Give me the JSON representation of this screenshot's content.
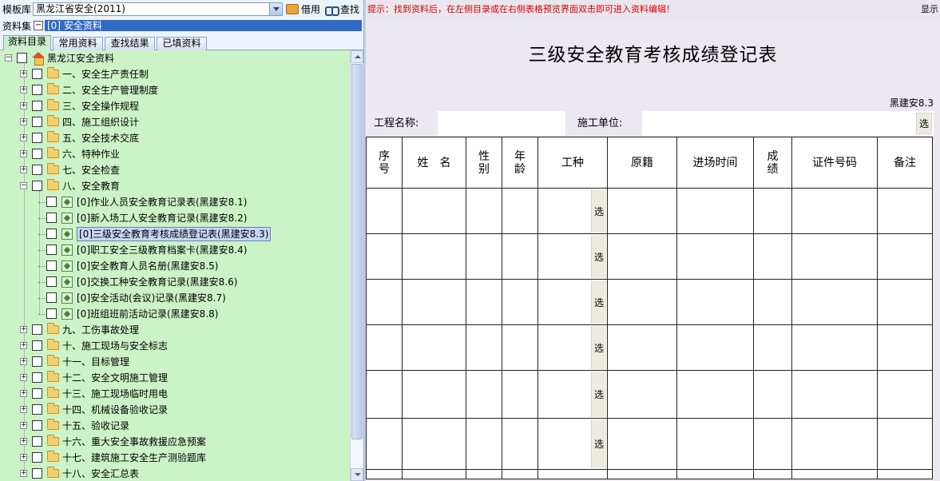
{
  "toolbar": {
    "template_label": "模板库",
    "template_value": "黑龙江省安全(2011)",
    "borrow_label": "借用",
    "find_label": "查找"
  },
  "dataset": {
    "label": "资料集",
    "toggle": "−",
    "value": "[0] 安全资料"
  },
  "tabs": [
    "资料目录",
    "常用资料",
    "查找结果",
    "已填资料"
  ],
  "tree": {
    "root": "黑龙江安全资料",
    "folders_top": [
      "一、安全生产责任制",
      "二、安全生产管理制度",
      "三、安全操作规程",
      "四、施工组织设计",
      "五、安全技术交底",
      "六、特种作业",
      "七、安全检查",
      "八、安全教育"
    ],
    "docs": [
      "[0]作业人员安全教育记录表(黑建安8.1)",
      "[0]新入场工人安全教育记录(黑建安8.2)",
      "[0]三级安全教育考核成绩登记表(黑建安8.3)",
      "[0]职工安全三级教育档案卡(黑建安8.4)",
      "[0]安全教育人员名册(黑建安8.5)",
      "[0]交换工种安全教育记录(黑建安8.6)",
      "[0]安全活动(会议)记录(黑建安8.7)",
      "[0]班组班前活动记录(黑建安8.8)"
    ],
    "folders_bottom": [
      "九、工伤事故处理",
      "十、施工现场与安全标志",
      "十一、目标管理",
      "十二、安全文明施工管理",
      "十三、施工现场临时用电",
      "十四、机械设备验收记录",
      "十五、验收记录",
      "十六、重大安全事故救援应急预案",
      "十七、建筑施工安全生产测验题库",
      "十八、安全汇总表"
    ]
  },
  "right": {
    "hint": "提示：找到资料后，在左侧目录或在右侧表格预览界面双击即可进入资料编辑！",
    "show_label": "显示",
    "title": "三级安全教育考核成绩登记表",
    "code": "黑建安8.3",
    "project_label": "工程名称:",
    "unit_label": "施工单位:",
    "pick": "选",
    "columns": [
      "序号",
      "姓　名",
      "性别",
      "年龄",
      "工种",
      "原籍",
      "进场时间",
      "成绩",
      "证件号码",
      "备注"
    ]
  }
}
